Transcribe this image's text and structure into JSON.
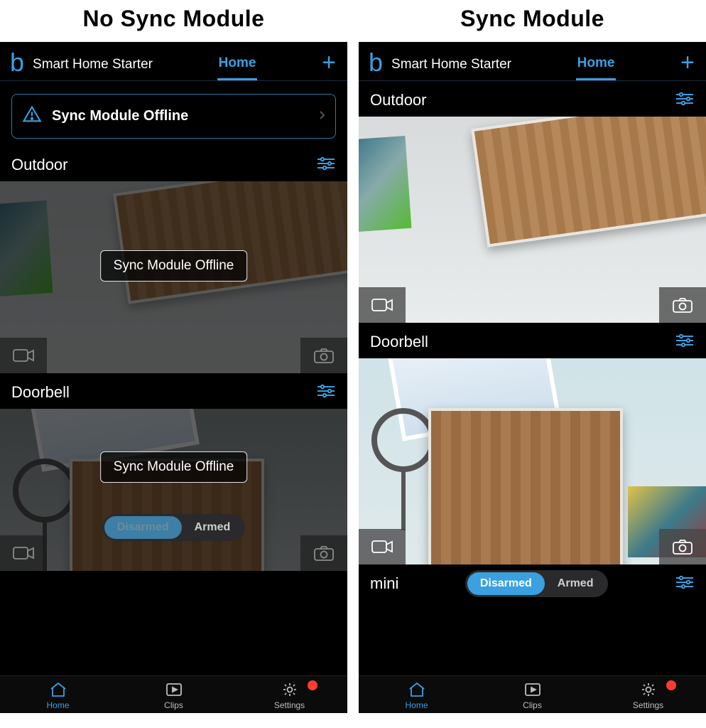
{
  "columns": {
    "left_title": "No Sync Module",
    "right_title": "Sync Module"
  },
  "common": {
    "logo_glyph": "b",
    "account": "Smart Home Starter",
    "tab_home": "Home",
    "arm": {
      "disarmed": "Disarmed",
      "armed": "Armed"
    },
    "tabbar": {
      "home": "Home",
      "clips": "Clips",
      "settings": "Settings"
    }
  },
  "left": {
    "banner_text": "Sync Module Offline",
    "cameras": [
      {
        "name": "Outdoor",
        "overlay": "Sync Module Offline"
      },
      {
        "name": "Doorbell",
        "overlay": "Sync Module Offline"
      }
    ],
    "arm_active": "disarmed"
  },
  "right": {
    "cameras": [
      {
        "name": "Outdoor"
      },
      {
        "name": "Doorbell"
      },
      {
        "name": "mini"
      }
    ],
    "arm_active": "disarmed"
  }
}
